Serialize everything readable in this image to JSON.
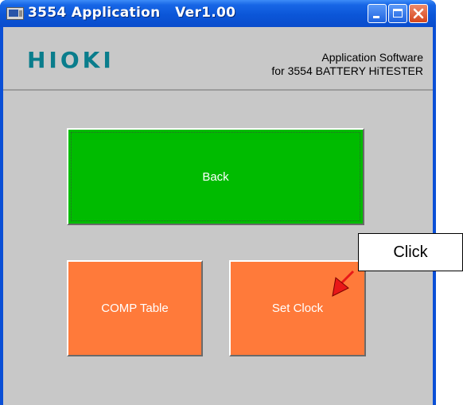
{
  "window": {
    "title": "3554 Application   Ver1.00"
  },
  "header": {
    "logo_text": "HIOKI",
    "subtitle_line1": "Application Software",
    "subtitle_line2": "for 3554 BATTERY HiTESTER"
  },
  "buttons": {
    "back_label": "Back",
    "comp_table_label": "COMP Table",
    "set_clock_label": "Set Clock"
  },
  "annotation": {
    "callout_text": "Click"
  },
  "colors": {
    "back_button": "#00bb00",
    "action_buttons": "#ff7a3a",
    "arrow": "#e81818",
    "logo": "#0a7d8c"
  },
  "icons": {
    "app_icon": "app-window-icon",
    "minimize": "minimize-icon",
    "maximize": "maximize-icon",
    "close": "close-icon",
    "pointer": "red-arrow-icon"
  }
}
